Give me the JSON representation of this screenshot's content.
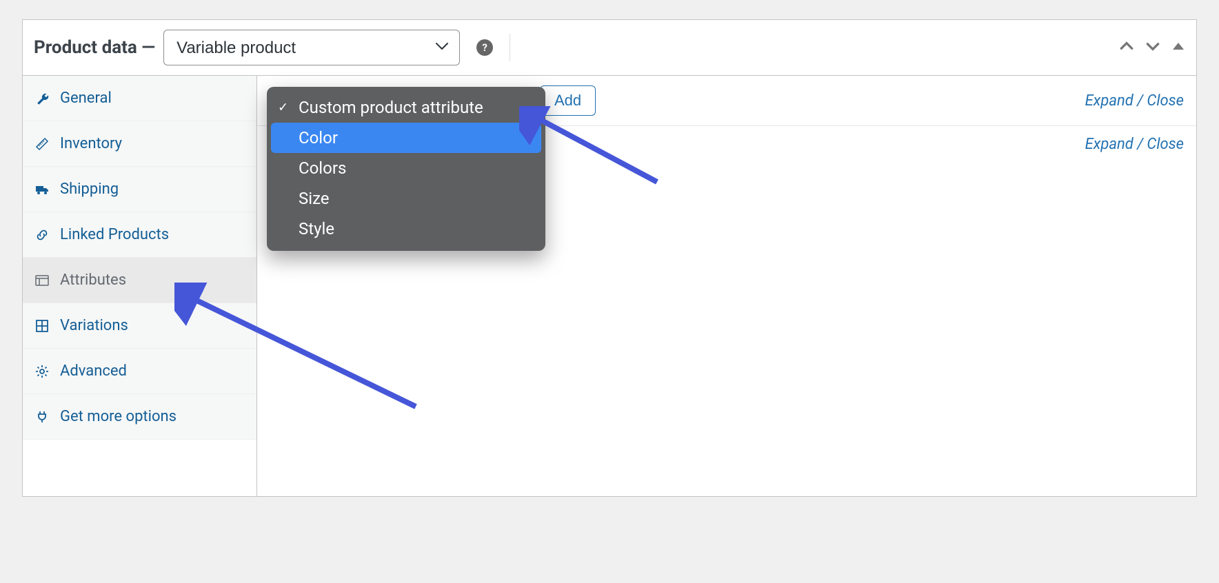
{
  "header": {
    "title": "Product data —",
    "product_type_selected": "Variable product",
    "help_glyph": "?"
  },
  "sidebar": {
    "items": [
      {
        "label": "General"
      },
      {
        "label": "Inventory"
      },
      {
        "label": "Shipping"
      },
      {
        "label": "Linked Products"
      },
      {
        "label": "Attributes"
      },
      {
        "label": "Variations"
      },
      {
        "label": "Advanced"
      },
      {
        "label": "Get more options"
      }
    ]
  },
  "attributes_panel": {
    "add_button_label": "Add",
    "expand_close_label": "Expand / Close",
    "dropdown": {
      "options": [
        {
          "label": "Custom product attribute",
          "selected": true
        },
        {
          "label": "Color",
          "highlighted": true
        },
        {
          "label": "Colors"
        },
        {
          "label": "Size"
        },
        {
          "label": "Style"
        }
      ]
    }
  }
}
